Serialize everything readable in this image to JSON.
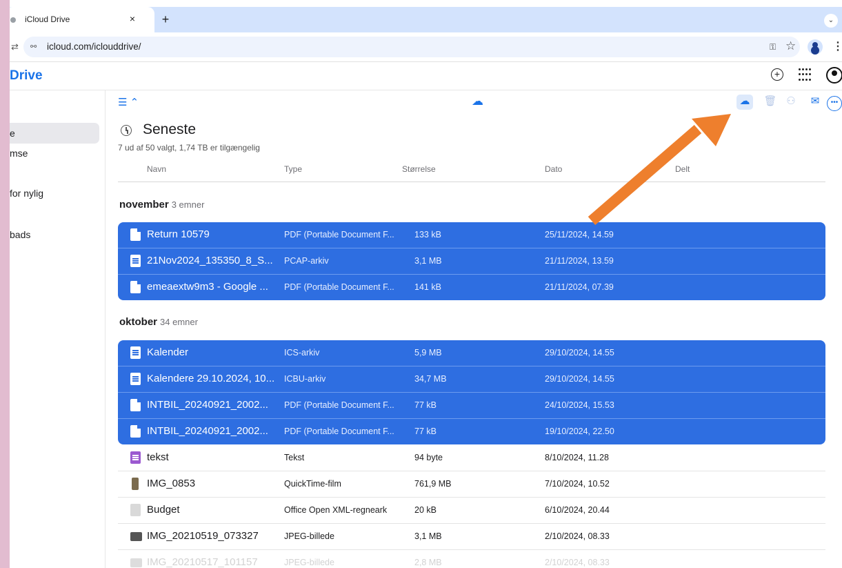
{
  "browser": {
    "tab_title": "iCloud Drive",
    "tab_close": "×",
    "new_tab": "+",
    "tab_dropdown": "⌄",
    "url": "icloud.com/iclouddrive/",
    "back": "⇄",
    "site_info": "⚯",
    "key": "⚿",
    "star": "☆",
    "menu": "⋮"
  },
  "app": {
    "title": "Drive",
    "add": "+"
  },
  "sidebar": {
    "items": [
      "e",
      "mse",
      "for nylig",
      "bads"
    ]
  },
  "toolbar": {
    "list_view": "☰ ⌃",
    "upload": "☁",
    "download": "☁",
    "trash": "🗑",
    "share": "⚇",
    "mail": "✉",
    "more": "•••"
  },
  "page": {
    "title": "Seneste",
    "selection_info": "7 ud af 50 valgt, 1,74 TB er tilgængelig"
  },
  "columns": {
    "name": "Navn",
    "type": "Type",
    "size": "Størrelse",
    "date": "Dato",
    "shared": "Delt"
  },
  "groups": [
    {
      "label": "november",
      "count": "3 emner",
      "rows": [
        {
          "name": "Return 10579",
          "type": "PDF (Portable Document F...",
          "size": "133 kB",
          "date": "25/11/2024, 14.59",
          "icon": "pdf-icon",
          "selected": true
        },
        {
          "name": "21Nov2024_135350_8_S...",
          "type": "PCAP-arkiv",
          "size": "3,1 MB",
          "date": "21/11/2024, 13.59",
          "icon": "document-icon",
          "selected": true
        },
        {
          "name": "emeaextw9m3 - Google ...",
          "type": "PDF (Portable Document F...",
          "size": "141 kB",
          "date": "21/11/2024, 07.39",
          "icon": "pdf-icon",
          "selected": true
        }
      ]
    },
    {
      "label": "oktober",
      "count": "34 emner",
      "rows": [
        {
          "name": "Kalender",
          "type": "ICS-arkiv",
          "size": "5,9 MB",
          "date": "29/10/2024, 14.55",
          "icon": "document-icon",
          "selected": true
        },
        {
          "name": "Kalendere 29.10.2024, 10...",
          "type": "ICBU-arkiv",
          "size": "34,7 MB",
          "date": "29/10/2024, 14.55",
          "icon": "document-icon",
          "selected": true
        },
        {
          "name": "INTBIL_20240921_2002...",
          "type": "PDF (Portable Document F...",
          "size": "77 kB",
          "date": "24/10/2024, 15.53",
          "icon": "pdf-icon",
          "selected": true
        },
        {
          "name": "INTBIL_20240921_2002...",
          "type": "PDF (Portable Document F...",
          "size": "77 kB",
          "date": "19/10/2024, 22.50",
          "icon": "pdf-icon",
          "selected": true
        },
        {
          "name": "tekst",
          "type": "Tekst",
          "size": "94 byte",
          "date": "8/10/2024, 11.28",
          "icon": "text-icon",
          "selected": false
        },
        {
          "name": "IMG_0853",
          "type": "QuickTime-film",
          "size": "761,9 MB",
          "date": "7/10/2024, 10.52",
          "icon": "movie-icon",
          "selected": false
        },
        {
          "name": "Budget",
          "type": "Office Open XML-regneark",
          "size": "20 kB",
          "date": "6/10/2024, 20.44",
          "icon": "spreadsheet-icon",
          "selected": false
        },
        {
          "name": "IMG_20210519_073327",
          "type": "JPEG-billede",
          "size": "3,1 MB",
          "date": "2/10/2024, 08.33",
          "icon": "image-icon",
          "selected": false
        },
        {
          "name": "IMG_20210517_101157",
          "type": "JPEG-billede",
          "size": "2,8 MB",
          "date": "2/10/2024, 08.33",
          "icon": "image-icon",
          "selected": false
        }
      ]
    }
  ],
  "colors": {
    "accent": "#1a73e8",
    "selection": "#2e6ee1",
    "arrow": "#ee7f2d",
    "backdrop": "#e2bcd0"
  }
}
